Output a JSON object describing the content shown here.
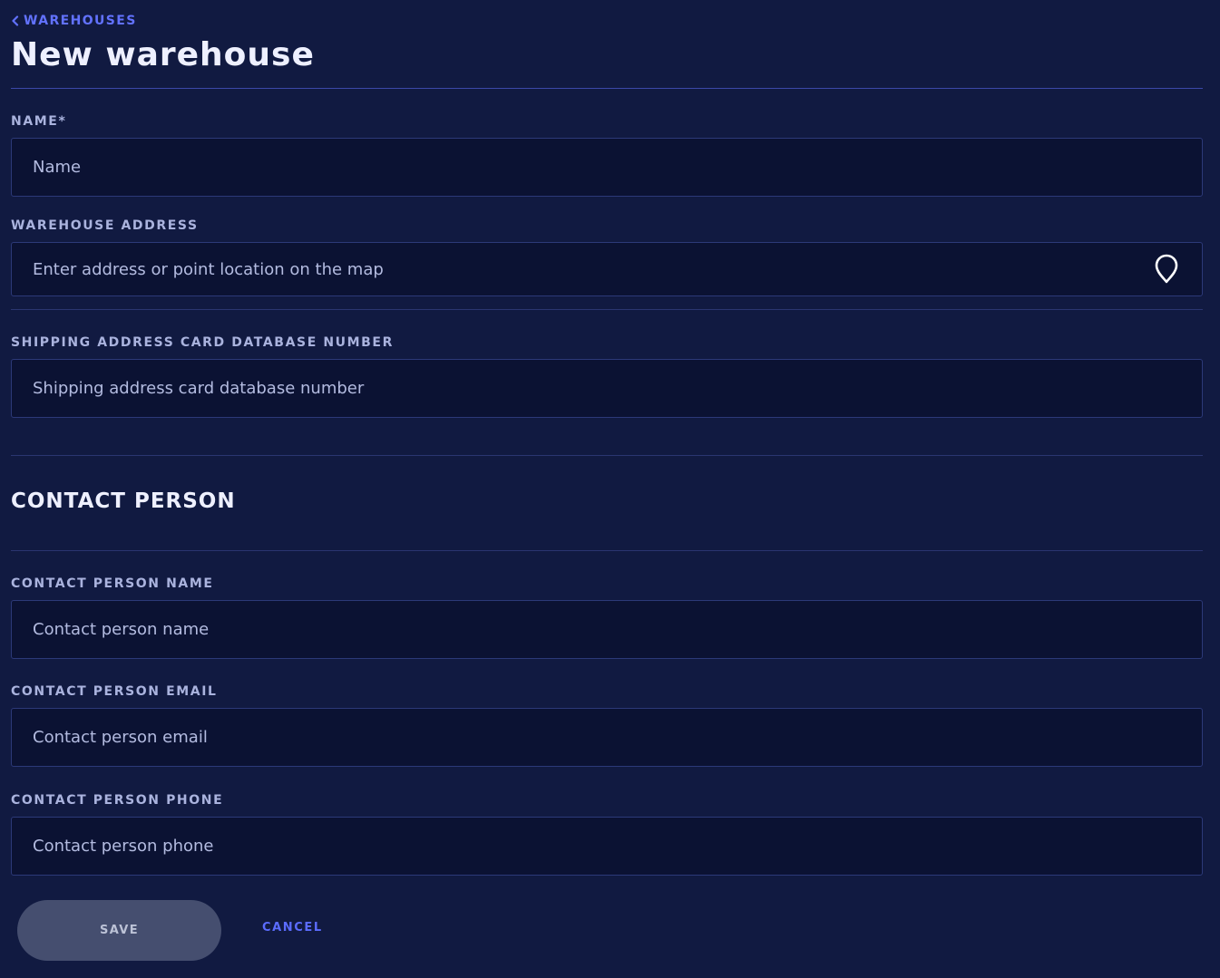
{
  "breadcrumb": {
    "back_label": "WAREHOUSES"
  },
  "page": {
    "title": "New warehouse"
  },
  "form": {
    "name": {
      "label": "NAME*",
      "placeholder": "Name",
      "value": ""
    },
    "address": {
      "label": "WAREHOUSE ADDRESS",
      "placeholder": "Enter address or point location on the map",
      "value": ""
    },
    "shipping_card": {
      "label": "SHIPPING ADDRESS CARD DATABASE NUMBER",
      "placeholder": "Shipping address card database number",
      "value": ""
    }
  },
  "contact": {
    "section_title": "CONTACT PERSON",
    "name": {
      "label": "CONTACT PERSON NAME",
      "placeholder": "Contact person name",
      "value": ""
    },
    "email": {
      "label": "CONTACT PERSON EMAIL",
      "placeholder": "Contact person email",
      "value": ""
    },
    "phone": {
      "label": "CONTACT PERSON PHONE",
      "placeholder": "Contact person phone",
      "value": ""
    }
  },
  "actions": {
    "save_label": "SAVE",
    "cancel_label": "CANCEL"
  },
  "icons": {
    "back": "chevron-left-icon",
    "location": "map-pin-icon"
  },
  "colors": {
    "background": "#111a41",
    "input_background": "#0b1233",
    "accent": "#5b6cff",
    "label": "#aab3de",
    "save_button": "#454e6f"
  }
}
